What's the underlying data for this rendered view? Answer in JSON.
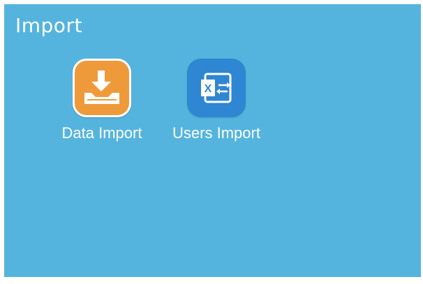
{
  "page": {
    "title": "Import"
  },
  "items": [
    {
      "label": "Data Import",
      "icon": "download-tray-icon",
      "color": "#ef9a3a"
    },
    {
      "label": "Users Import",
      "icon": "excel-import-icon",
      "color": "#2f86d2"
    }
  ],
  "colors": {
    "background": "#55b4de",
    "text": "#ffffff"
  }
}
